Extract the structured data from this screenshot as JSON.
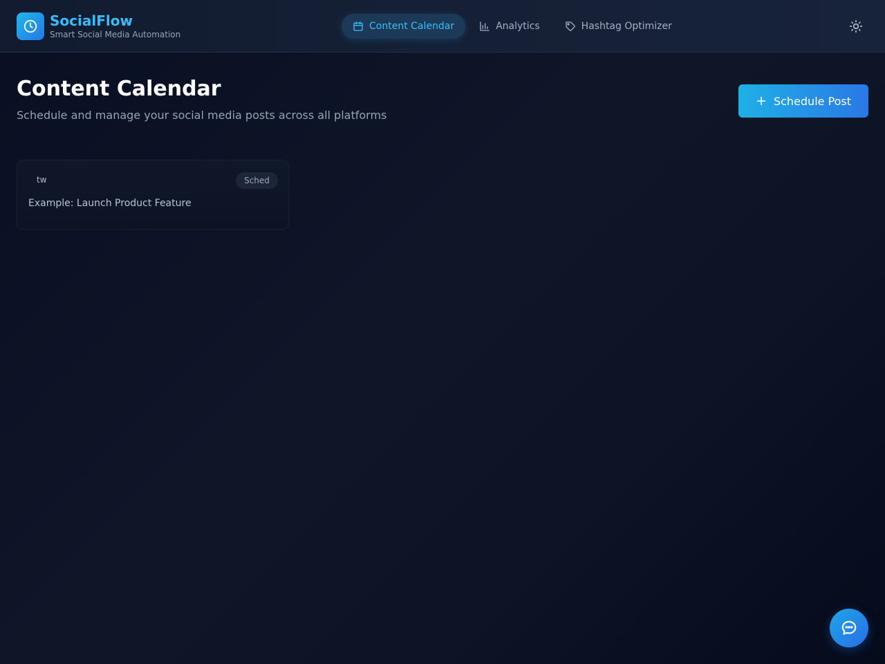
{
  "brand": {
    "name": "SocialFlow",
    "tagline": "Smart Social Media Automation",
    "logo_icon": "clock-icon"
  },
  "nav": {
    "tabs": [
      {
        "label": "Content Calendar",
        "icon": "calendar-icon",
        "active": true
      },
      {
        "label": "Analytics",
        "icon": "bar-chart-icon",
        "active": false
      },
      {
        "label": "Hashtag Optimizer",
        "icon": "tag-icon",
        "active": false
      }
    ]
  },
  "header": {
    "theme_toggle_icon": "sun-icon"
  },
  "main": {
    "title": "Content Calendar",
    "subtitle": "Schedule and manage your social media posts across all platforms",
    "schedule_button_label": "Schedule Post",
    "schedule_button_icon": "plus-icon"
  },
  "posts": [
    {
      "platform": "tw",
      "status": "Sched",
      "title": "Example: Launch Product Feature"
    }
  ],
  "chat": {
    "icon": "chat-bubble-icon"
  },
  "colors": {
    "accent": "#38bdf8",
    "primary_gradient_start": "#1fb0e6",
    "primary_gradient_end": "#2a78e6",
    "background": "#0e1628",
    "muted_text": "#94a3b8"
  }
}
